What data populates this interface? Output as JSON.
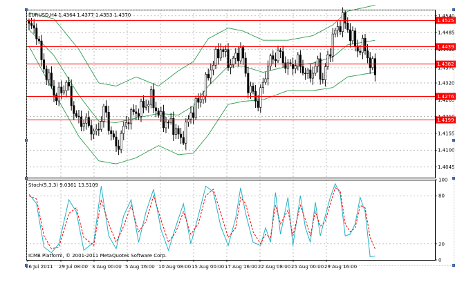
{
  "window": {
    "main_pane_title": "EURUSD,H4  1.4364 1.4377 1.4353 1.4370",
    "sub_pane_title": "Stoch(5,3,3) 9.0361 13.5109",
    "copyright": "ICMB Platform, © 2001-2011 MetaQuotes Software Corp."
  },
  "colors": {
    "background": "#ffffff",
    "grid": "#a0a0a0",
    "candle": "#000000",
    "bollinger": "#2e9e4f",
    "level_line": "#ff0000",
    "level_label_bg": "#ff0000",
    "stoch_main": "#20b2c8",
    "stoch_signal": "#ff0000",
    "handle": "#3a5f9e"
  },
  "chart_data": [
    {
      "type": "candlestick",
      "symbol": "EURUSD",
      "timeframe": "H4",
      "ohlc_current": {
        "open": 1.4364,
        "high": 1.4377,
        "low": 1.4353,
        "close": 1.437
      },
      "ylim": [
        1.401,
        1.456
      ],
      "y_ticks": [
        "1.4540",
        "1.4485",
        "1.4430",
        "1.4370",
        "1.4320",
        "1.4265",
        "1.4210",
        "1.4155",
        "1.4100",
        "1.4045"
      ],
      "x_ticks": [
        "26 Jul 2011",
        "29 Jul 08:00",
        "3 Aug 00:00",
        "5 Aug 16:00",
        "10 Aug 08:00",
        "15 Aug 00:00",
        "17 Aug 16:00",
        "22 Aug 08:00",
        "25 Aug 00:00",
        "29 Aug 16:00"
      ],
      "price_levels": [
        {
          "label": "1.4525",
          "value": 1.4525
        },
        {
          "label": "1.4439",
          "value": 1.4439
        },
        {
          "label": "1.4382",
          "value": 1.4382
        },
        {
          "label": "1.4276",
          "value": 1.4276
        },
        {
          "label": "1.4199",
          "value": 1.4199
        }
      ],
      "close_anchors": [
        [
          0,
          1.4505
        ],
        [
          3,
          1.449
        ],
        [
          5,
          1.439
        ],
        [
          8,
          1.433
        ],
        [
          11,
          1.427
        ],
        [
          15,
          1.432
        ],
        [
          19,
          1.42
        ],
        [
          23,
          1.419
        ],
        [
          27,
          1.415
        ],
        [
          30,
          1.4235
        ],
        [
          35,
          1.4105
        ],
        [
          40,
          1.421
        ],
        [
          45,
          1.4235
        ],
        [
          49,
          1.427
        ],
        [
          53,
          1.42
        ],
        [
          58,
          1.418
        ],
        [
          61,
          1.413
        ],
        [
          65,
          1.422
        ],
        [
          69,
          1.427
        ],
        [
          73,
          1.437
        ],
        [
          77,
          1.4435
        ],
        [
          81,
          1.438
        ],
        [
          85,
          1.443
        ],
        [
          88,
          1.431
        ],
        [
          92,
          1.4255
        ],
        [
          96,
          1.438
        ],
        [
          100,
          1.442
        ],
        [
          104,
          1.437
        ],
        [
          108,
          1.439
        ],
        [
          112,
          1.434
        ],
        [
          116,
          1.438
        ],
        [
          118,
          1.433
        ],
        [
          122,
          1.447
        ],
        [
          126,
          1.453
        ],
        [
          129,
          1.448
        ],
        [
          132,
          1.443
        ],
        [
          135,
          1.444
        ],
        [
          137,
          1.4375
        ],
        [
          139,
          1.437
        ]
      ],
      "bollinger_bands": {
        "upper": [
          [
            0,
            1.455
          ],
          [
            10,
            1.453
          ],
          [
            20,
            1.443
          ],
          [
            28,
            1.432
          ],
          [
            35,
            1.431
          ],
          [
            43,
            1.434
          ],
          [
            52,
            1.431
          ],
          [
            60,
            1.436
          ],
          [
            66,
            1.439
          ],
          [
            72,
            1.4465
          ],
          [
            80,
            1.45
          ],
          [
            86,
            1.449
          ],
          [
            94,
            1.446
          ],
          [
            104,
            1.446
          ],
          [
            114,
            1.4475
          ],
          [
            122,
            1.451
          ],
          [
            128,
            1.4555
          ],
          [
            139,
            1.4575
          ]
        ],
        "middle": [
          [
            0,
            1.4495
          ],
          [
            10,
            1.441
          ],
          [
            20,
            1.428
          ],
          [
            28,
            1.4195
          ],
          [
            35,
            1.419
          ],
          [
            43,
            1.4205
          ],
          [
            52,
            1.422
          ],
          [
            60,
            1.4215
          ],
          [
            66,
            1.4245
          ],
          [
            72,
            1.431
          ],
          [
            80,
            1.4375
          ],
          [
            86,
            1.4375
          ],
          [
            94,
            1.4355
          ],
          [
            104,
            1.4375
          ],
          [
            114,
            1.4385
          ],
          [
            122,
            1.4405
          ],
          [
            128,
            1.4445
          ],
          [
            139,
            1.446
          ]
        ],
        "lower": [
          [
            0,
            1.444
          ],
          [
            10,
            1.429
          ],
          [
            20,
            1.4145
          ],
          [
            28,
            1.4065
          ],
          [
            35,
            1.4055
          ],
          [
            43,
            1.4075
          ],
          [
            52,
            1.4115
          ],
          [
            60,
            1.4085
          ],
          [
            66,
            1.409
          ],
          [
            72,
            1.415
          ],
          [
            80,
            1.425
          ],
          [
            86,
            1.426
          ],
          [
            94,
            1.4265
          ],
          [
            104,
            1.4295
          ],
          [
            114,
            1.4295
          ],
          [
            122,
            1.4305
          ],
          [
            128,
            1.434
          ],
          [
            139,
            1.4355
          ]
        ]
      }
    },
    {
      "type": "line",
      "indicator": "Stoch(5,3,3)",
      "ylim": [
        0,
        100
      ],
      "y_ticks": [
        "100",
        "80",
        "20",
        "0"
      ],
      "series": [
        {
          "name": "main",
          "value_last": 9.0361,
          "points": [
            [
              0,
              82
            ],
            [
              3,
              70
            ],
            [
              6,
              16
            ],
            [
              9,
              9
            ],
            [
              12,
              20
            ],
            [
              16,
              75
            ],
            [
              19,
              60
            ],
            [
              22,
              12
            ],
            [
              26,
              22
            ],
            [
              29,
              92
            ],
            [
              32,
              30
            ],
            [
              35,
              14
            ],
            [
              38,
              55
            ],
            [
              41,
              75
            ],
            [
              44,
              22
            ],
            [
              47,
              60
            ],
            [
              50,
              88
            ],
            [
              53,
              38
            ],
            [
              56,
              12
            ],
            [
              59,
              42
            ],
            [
              62,
              70
            ],
            [
              65,
              20
            ],
            [
              68,
              55
            ],
            [
              71,
              92
            ],
            [
              74,
              85
            ],
            [
              77,
              42
            ],
            [
              80,
              18
            ],
            [
              83,
              52
            ],
            [
              85,
              90
            ],
            [
              87,
              58
            ],
            [
              90,
              22
            ],
            [
              93,
              18
            ],
            [
              95,
              40
            ],
            [
              97,
              22
            ],
            [
              99,
              84
            ],
            [
              101,
              32
            ],
            [
              104,
              78
            ],
            [
              106,
              18
            ],
            [
              109,
              80
            ],
            [
              111,
              40
            ],
            [
              113,
              22
            ],
            [
              115,
              72
            ],
            [
              117,
              30
            ],
            [
              119,
              55
            ],
            [
              121,
              78
            ],
            [
              123,
              95
            ],
            [
              125,
              82
            ],
            [
              127,
              30
            ],
            [
              129,
              32
            ],
            [
              131,
              45
            ],
            [
              133,
              78
            ],
            [
              135,
              60
            ],
            [
              137,
              4
            ],
            [
              139,
              5
            ]
          ]
        },
        {
          "name": "signal",
          "value_last": 13.5109,
          "points": [
            [
              0,
              80
            ],
            [
              3,
              76
            ],
            [
              6,
              30
            ],
            [
              9,
              14
            ],
            [
              12,
              16
            ],
            [
              16,
              58
            ],
            [
              19,
              65
            ],
            [
              22,
              28
            ],
            [
              26,
              18
            ],
            [
              29,
              75
            ],
            [
              32,
              45
            ],
            [
              35,
              22
            ],
            [
              38,
              42
            ],
            [
              41,
              68
            ],
            [
              44,
              35
            ],
            [
              47,
              48
            ],
            [
              50,
              80
            ],
            [
              53,
              50
            ],
            [
              56,
              22
            ],
            [
              59,
              35
            ],
            [
              62,
              60
            ],
            [
              65,
              32
            ],
            [
              68,
              45
            ],
            [
              71,
              80
            ],
            [
              74,
              88
            ],
            [
              77,
              58
            ],
            [
              80,
              28
            ],
            [
              83,
              40
            ],
            [
              85,
              78
            ],
            [
              87,
              70
            ],
            [
              90,
              35
            ],
            [
              93,
              20
            ],
            [
              95,
              32
            ],
            [
              97,
              28
            ],
            [
              99,
              68
            ],
            [
              101,
              45
            ],
            [
              104,
              62
            ],
            [
              106,
              30
            ],
            [
              109,
              68
            ],
            [
              111,
              50
            ],
            [
              113,
              30
            ],
            [
              115,
              60
            ],
            [
              117,
              42
            ],
            [
              119,
              48
            ],
            [
              121,
              70
            ],
            [
              123,
              90
            ],
            [
              125,
              86
            ],
            [
              127,
              45
            ],
            [
              129,
              35
            ],
            [
              131,
              40
            ],
            [
              133,
              68
            ],
            [
              135,
              65
            ],
            [
              137,
              28
            ],
            [
              139,
              14
            ]
          ]
        }
      ]
    }
  ]
}
